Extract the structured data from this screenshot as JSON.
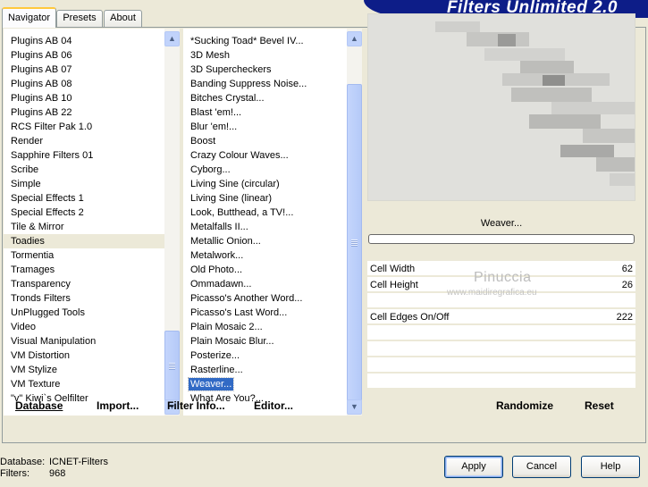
{
  "tabs": [
    {
      "label": "Navigator",
      "active": true
    },
    {
      "label": "Presets",
      "active": false
    },
    {
      "label": "About",
      "active": false
    }
  ],
  "banner": {
    "title": "Filters Unlimited 2.0",
    "color": "#0d1d88"
  },
  "categories": {
    "items": [
      "Plugins AB 04",
      "Plugins AB 06",
      "Plugins AB 07",
      "Plugins AB 08",
      "Plugins AB 10",
      "Plugins AB 22",
      "RCS Filter Pak 1.0",
      "Render",
      "Sapphire Filters 01",
      "Scribe",
      "Simple",
      "Special Effects 1",
      "Special Effects 2",
      "Tile & Mirror",
      "Toadies",
      "Tormentia",
      "Tramages",
      "Transparency",
      "Tronds Filters",
      "UnPlugged Tools",
      "Video",
      "Visual Manipulation",
      "VM Distortion",
      "VM Stylize",
      "VM Texture",
      "\"v\" Kiwi`s Oelfilter"
    ],
    "selected": "Toadies"
  },
  "filters": {
    "items": [
      "*Sucking Toad*  Bevel IV...",
      "3D Mesh",
      "3D Supercheckers",
      "Banding Suppress Noise...",
      "Bitches Crystal...",
      "Blast 'em!...",
      "Blur 'em!...",
      "Boost",
      "Crazy Colour Waves...",
      "Cyborg...",
      "Living Sine (circular)",
      "Living Sine (linear)",
      "Look, Butthead, a TV!...",
      "Metalfalls II...",
      "Metallic Onion...",
      "Metalwork...",
      "Old Photo...",
      "Ommadawn...",
      "Picasso's Another Word...",
      "Picasso's Last Word...",
      "Plain Mosaic 2...",
      "Plain Mosaic Blur...",
      "Posterize...",
      "Rasterline...",
      "Weaver...",
      "What Are You?..."
    ],
    "selected": "Weaver..."
  },
  "preview": {
    "filter_name": "Weaver..."
  },
  "params": [
    {
      "label": "Cell Width",
      "value": "62",
      "level": 0.24
    },
    {
      "label": "Cell Height",
      "value": "26",
      "level": 0.1
    },
    {
      "label": "Cell Edges On/Off",
      "value": "222",
      "level": 0.87
    }
  ],
  "watermark": {
    "line1": "Pinuccia",
    "line2": "www.maidiregrafica.eu"
  },
  "toolbar": {
    "database": "Database",
    "import": "Import...",
    "filter_info": "Filter Info...",
    "editor": "Editor...",
    "randomize": "Randomize",
    "reset": "Reset"
  },
  "footer": {
    "database_label": "Database:",
    "database_value": "ICNET-Filters",
    "filters_label": "Filters:",
    "filters_value": "968"
  },
  "buttons": {
    "apply": "Apply",
    "cancel": "Cancel",
    "help": "Help"
  },
  "colors": {
    "selection": "#316ac5",
    "panel": "#ece9d8"
  }
}
